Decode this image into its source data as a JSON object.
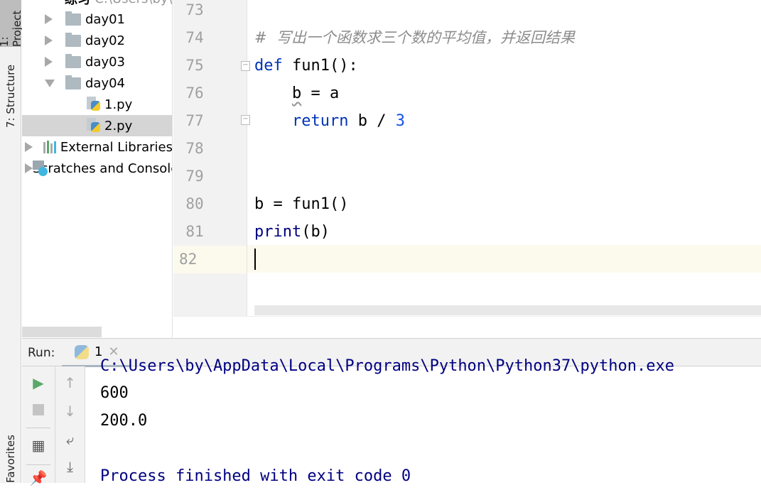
{
  "left_stripe": {
    "tabs": [
      {
        "label": "1: Project"
      },
      {
        "label": "7: Structure"
      },
      {
        "label": "Favorites"
      }
    ]
  },
  "project_tree": {
    "root": {
      "label": "练习",
      "path": "C:\\Users\\by\\"
    },
    "items": [
      {
        "label": "day01",
        "type": "folder",
        "expanded": false
      },
      {
        "label": "day02",
        "type": "folder",
        "expanded": false
      },
      {
        "label": "day03",
        "type": "folder",
        "expanded": false
      },
      {
        "label": "day04",
        "type": "folder",
        "expanded": true
      },
      {
        "label": "1.py",
        "type": "python-file"
      },
      {
        "label": "2.py",
        "type": "python-file",
        "selected": true
      },
      {
        "label": "External Libraries",
        "type": "libraries"
      },
      {
        "label": "Scratches and Consoles",
        "type": "scratches"
      }
    ]
  },
  "editor": {
    "line_numbers": [
      "73",
      "74",
      "75",
      "76",
      "77",
      "78",
      "79",
      "80",
      "81",
      "82"
    ],
    "current_line": "82",
    "lines": {
      "l74": {
        "comment": "#  写出一个函数求三个数的平均值，并返回结果"
      },
      "l75": {
        "kw": "def",
        "rest": " fun1():"
      },
      "l76": {
        "indent": "    ",
        "var": "b",
        "rest": " = a"
      },
      "l77": {
        "indent": "    ",
        "kw": "return",
        "mid": " b / ",
        "num": "3"
      },
      "l80": {
        "text": "b = fun1()"
      },
      "l81": {
        "builtin": "print",
        "rest": "(b)"
      }
    }
  },
  "run_panel": {
    "label": "Run:",
    "tab": {
      "label": "1",
      "icon": "python-icon"
    },
    "output": [
      {
        "text": "C:\\Users\\by\\AppData\\Local\\Programs\\Python\\Python37\\python.exe"
      },
      {
        "text": "600"
      },
      {
        "text": "200.0"
      },
      {
        "text": ""
      },
      {
        "text": "Process finished with exit code 0"
      }
    ]
  },
  "colors": {
    "keyword": "#0033b3",
    "number": "#1750eb",
    "comment": "#8c8c8c",
    "builtin": "#000080",
    "current_line": "#fcfaed",
    "run_green": "#59a869"
  }
}
